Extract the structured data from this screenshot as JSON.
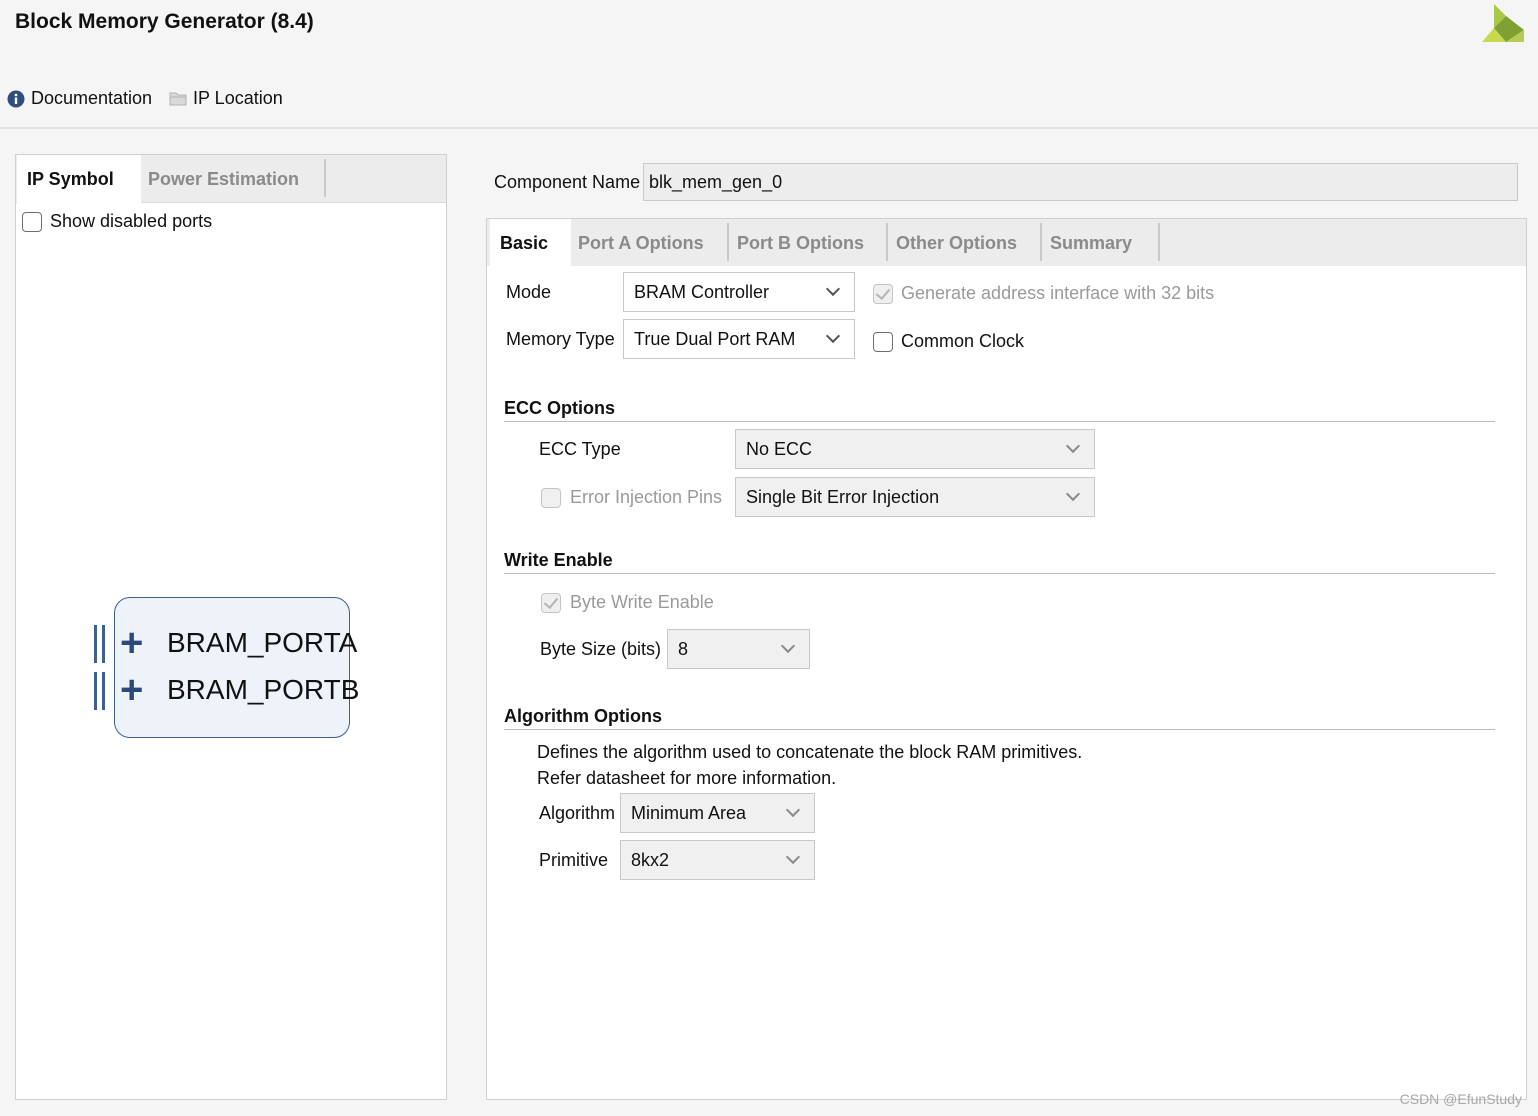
{
  "window": {
    "title": "Block Memory Generator (8.4)"
  },
  "toolbar": {
    "documentation_label": "Documentation",
    "ip_location_label": "IP Location"
  },
  "left_panel": {
    "tabs": [
      {
        "label": "IP Symbol",
        "active": true
      },
      {
        "label": "Power Estimation",
        "active": false
      }
    ],
    "show_disabled_ports_label": "Show disabled ports",
    "show_disabled_ports_checked": false,
    "symbol": {
      "ports": [
        {
          "label": "BRAM_PORTA"
        },
        {
          "label": "BRAM_PORTB"
        }
      ]
    }
  },
  "component": {
    "label": "Component Name",
    "value": "blk_mem_gen_0"
  },
  "right_panel": {
    "tabs": [
      {
        "label": "Basic",
        "active": true
      },
      {
        "label": "Port A Options",
        "active": false
      },
      {
        "label": "Port B Options",
        "active": false
      },
      {
        "label": "Other Options",
        "active": false
      },
      {
        "label": "Summary",
        "active": false
      }
    ],
    "mode": {
      "label": "Mode",
      "value": "BRAM Controller"
    },
    "memory_type": {
      "label": "Memory Type",
      "value": "True Dual Port RAM"
    },
    "gen_address": {
      "label": "Generate address interface with 32 bits",
      "checked": true,
      "enabled": false
    },
    "common_clock": {
      "label": "Common Clock",
      "checked": false
    },
    "ecc": {
      "title": "ECC Options",
      "type_label": "ECC Type",
      "type_value": "No ECC",
      "error_injection_label": "Error Injection Pins",
      "error_injection_checked": false,
      "error_injection_value": "Single Bit Error Injection"
    },
    "write_enable": {
      "title": "Write Enable",
      "byte_write_label": "Byte Write Enable",
      "byte_write_checked": true,
      "byte_size_label": "Byte Size (bits)",
      "byte_size_value": "8"
    },
    "algorithm": {
      "title": "Algorithm Options",
      "description_line1": "Defines the algorithm used to concatenate the block RAM primitives.",
      "description_line2": "Refer datasheet for more information.",
      "algorithm_label": "Algorithm",
      "algorithm_value": "Minimum Area",
      "primitive_label": "Primitive",
      "primitive_value": "8kx2"
    }
  },
  "watermark": "CSDN @EfunStudy",
  "colors": {
    "accent_blue": "#2b4a7a",
    "logo_green": "#8db33a"
  }
}
